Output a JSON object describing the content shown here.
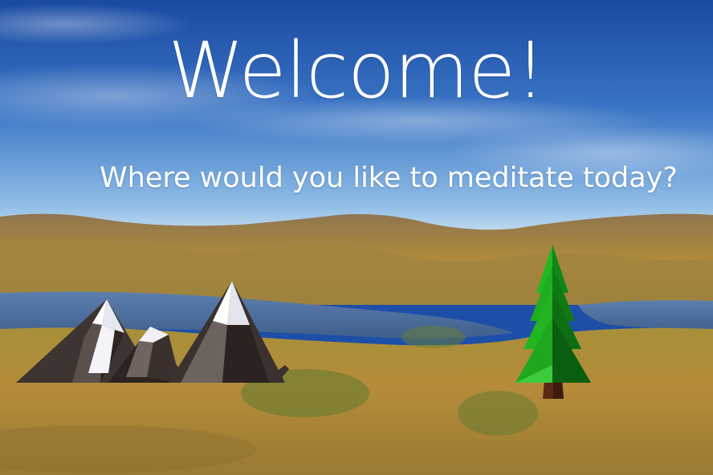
{
  "screen": {
    "title": "Welcome!",
    "subtitle": "Where would you like to meditate today?"
  },
  "choices": [
    {
      "name": "mountains",
      "icon": "mountains-icon"
    },
    {
      "name": "forest",
      "icon": "pine-tree-icon"
    }
  ],
  "colors": {
    "sky_top": "#1d4fa8",
    "sky_horizon": "#9fc6e8",
    "hills": "#b08a3c",
    "lake": "#4a6fa0",
    "grass": "#a9863a",
    "tree_green": "#1fae1f",
    "trunk": "#5a2a16",
    "rock": "#4a3f3b",
    "snow": "#ffffff"
  }
}
